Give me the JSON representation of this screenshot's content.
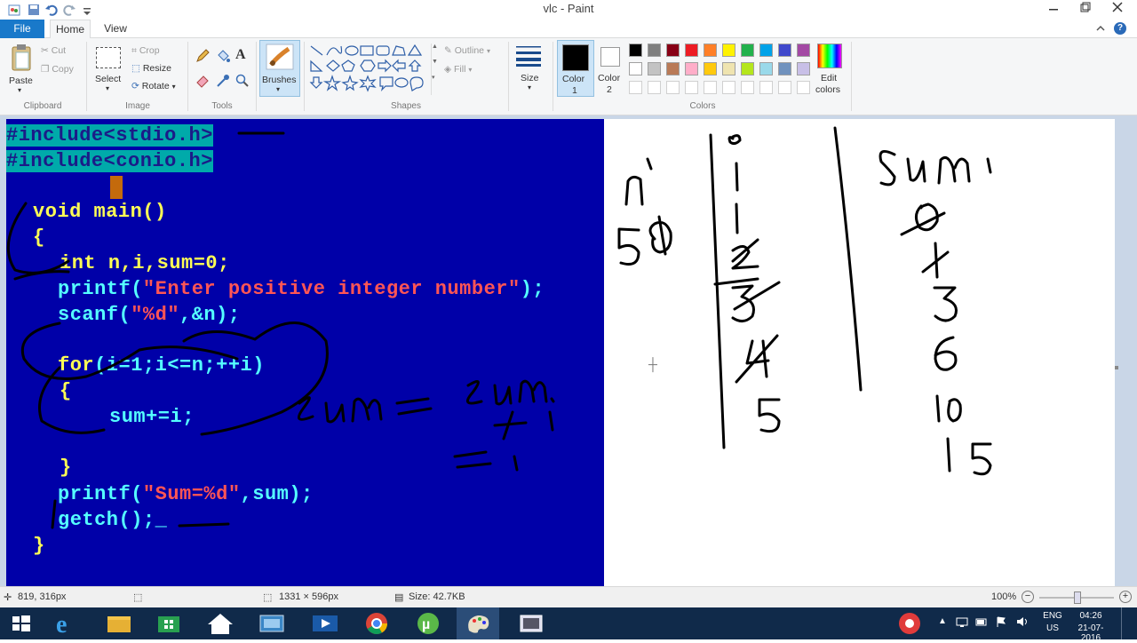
{
  "window": {
    "title": "vlc - Paint"
  },
  "tabs": {
    "file": "File",
    "home": "Home",
    "view": "View"
  },
  "ribbon": {
    "clipboard": {
      "paste": "Paste",
      "cut": "Cut",
      "copy": "Copy",
      "label": "Clipboard"
    },
    "image": {
      "select": "Select",
      "crop": "Crop",
      "resize": "Resize",
      "rotate": "Rotate",
      "label": "Image"
    },
    "tools": {
      "label": "Tools",
      "text_glyph": "A"
    },
    "brushes": {
      "label": "Brushes"
    },
    "shapes": {
      "outline": "Outline",
      "fill": "Fill",
      "label": "Shapes"
    },
    "size": {
      "label": "Size"
    },
    "colors": {
      "color1": "Color 1",
      "color1_l1": "Color",
      "color1_l2": "1",
      "color2_l1": "Color",
      "color2_l2": "2",
      "edit_l1": "Edit",
      "edit_l2": "colors",
      "label": "Colors",
      "row1": [
        "#000000",
        "#7f7f7f",
        "#880015",
        "#ed1c24",
        "#ff7f27",
        "#fff200",
        "#22b14c",
        "#00a2e8",
        "#3f48cc",
        "#a349a4"
      ],
      "row2": [
        "#ffffff",
        "#c3c3c3",
        "#b97a57",
        "#ffaec9",
        "#ffc90e",
        "#efe4b0",
        "#b5e61d",
        "#99d9ea",
        "#7092be",
        "#c8bfe7"
      ]
    }
  },
  "code": {
    "line1": "#include<stdio.h>",
    "line2": "#include<conio.h>",
    "line3": "void main()",
    "line4": "{",
    "line5_kw": "int ",
    "line5_rest": "n,i,sum=0;",
    "line6_fn": "printf(",
    "line6_str": "\"Enter positive integer number\"",
    "line6_end": ");",
    "line7_fn": "scanf(",
    "line7_str": "\"%d\"",
    "line7_end": ",&n);",
    "line8_kw": "for",
    "line8_rest": "(i=1;i<=n;++i)",
    "line9": "{",
    "line10": "sum+=i;",
    "line11": "}",
    "line12_fn": "printf(",
    "line12_str": "\"Sum=%d\"",
    "line12_end": ",sum);",
    "line13": "getch();_",
    "line14": "}"
  },
  "status": {
    "position": "819, 316px",
    "dimensions": "1331 × 596px",
    "size": "Size: 42.7KB",
    "zoom": "100%"
  },
  "taskbar": {
    "lang1": "ENG",
    "lang2": "US",
    "time": "04:26",
    "date": "21-07-2016"
  }
}
